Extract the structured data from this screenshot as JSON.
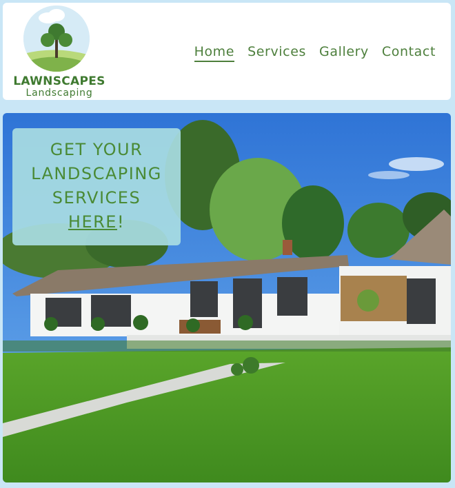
{
  "logo": {
    "title": "LAWNSCAPES",
    "subtitle": "Landscaping",
    "icon": "tree-icon"
  },
  "nav": {
    "items": [
      {
        "label": "Home",
        "active": true
      },
      {
        "label": "Services",
        "active": false
      },
      {
        "label": "Gallery",
        "active": false
      },
      {
        "label": "Contact",
        "active": false
      }
    ]
  },
  "hero": {
    "cta_line1": "GET YOUR",
    "cta_line2": "LANDSCAPING",
    "cta_line3": "SERVICES",
    "cta_link": "HERE",
    "cta_suffix": "!"
  },
  "colors": {
    "brand_green": "#4d7f3c",
    "page_bg": "#c9e6f6",
    "cta_bg": "#a8dce2"
  }
}
